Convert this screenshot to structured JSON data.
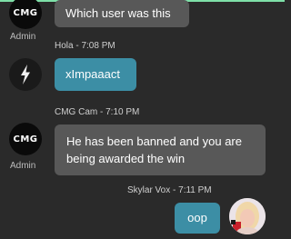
{
  "colors": {
    "background": "#2a2a2a",
    "bubble_gray": "#585858",
    "bubble_teal": "#3c8ea5",
    "accent_top": "#7ee0a8"
  },
  "messages": [
    {
      "avatar_text": "CMG",
      "role": "Admin",
      "text": "Which user was this"
    },
    {
      "meta": "Hola - 7:08 PM",
      "avatar_icon": "lightning-bolt-icon",
      "text": "xImpaaact"
    },
    {
      "meta": "CMG Cam - 7:10 PM",
      "avatar_text": "CMG",
      "role": "Admin",
      "text_line1": "He has been banned and you are",
      "text_line2": "being awarded the win"
    },
    {
      "meta": "Skylar Vox - 7:11 PM",
      "avatar_icon": "user-photo-avatar",
      "text": "oop"
    }
  ]
}
